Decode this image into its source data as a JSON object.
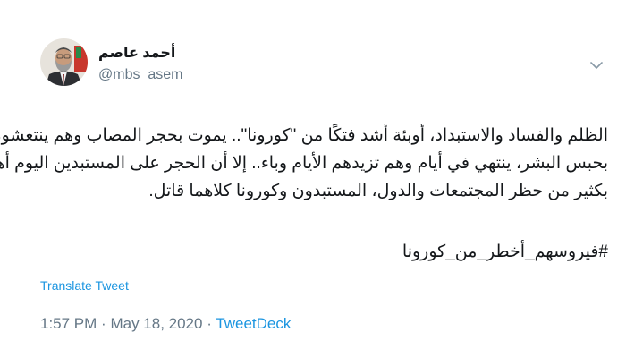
{
  "tweet": {
    "author": {
      "display_name": "أحمد عاصم",
      "handle": "@mbs_asem",
      "avatar": "profile-photo"
    },
    "menu_icon": "chevron-down-icon",
    "text_lines": [
      "الظلم والفساد والاستبداد، أوبئة أشد فتكًا من \"كورونا\".. يموت بحجر المصاب وهم ينتعشون",
      "بحبس البشر، ينتهي في أيام وهم تزيدهم الأيام وباء.. إلا أن الحجر على المستبدين اليوم أهم",
      "بكثير من حظر المجتمعات والدول، المستبدون وكورونا كلاهما قاتل."
    ],
    "hashtag": "#فيروسهم_أخطر_من_كورونا",
    "translate_label": "Translate Tweet",
    "time": "1:57 PM",
    "separator": "·",
    "date": "May 18, 2020",
    "source": "TweetDeck",
    "colors": {
      "text": "#14171a",
      "secondary": "#657786",
      "link": "#1b95e0"
    }
  }
}
